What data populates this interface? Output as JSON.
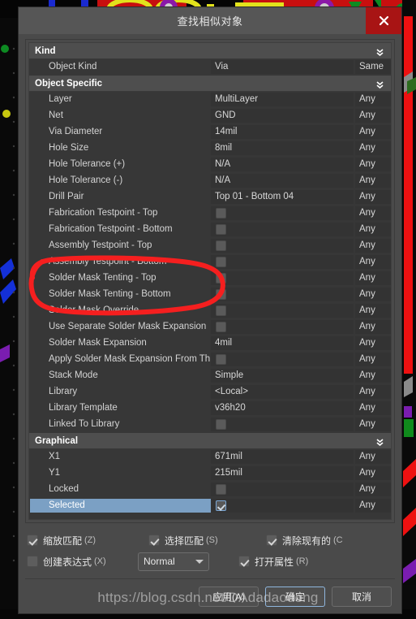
{
  "window": {
    "title": "查找相似对象",
    "close_label": "close-icon"
  },
  "grid": {
    "sections": [
      {
        "name": "Kind",
        "rows": [
          {
            "label": "Object Kind",
            "value": "Via",
            "type": "text",
            "mode": "Same"
          }
        ]
      },
      {
        "name": "Object Specific",
        "rows": [
          {
            "label": "Layer",
            "value": "MultiLayer",
            "type": "text",
            "mode": "Any"
          },
          {
            "label": "Net",
            "value": "GND",
            "type": "text",
            "mode": "Any"
          },
          {
            "label": "Via Diameter",
            "value": "14mil",
            "type": "text",
            "mode": "Any"
          },
          {
            "label": "Hole Size",
            "value": "8mil",
            "type": "text",
            "mode": "Any"
          },
          {
            "label": "Hole Tolerance (+)",
            "value": "N/A",
            "type": "text",
            "mode": "Any"
          },
          {
            "label": "Hole Tolerance (-)",
            "value": "N/A",
            "type": "text",
            "mode": "Any"
          },
          {
            "label": "Drill Pair",
            "value": "Top 01 - Bottom 04",
            "type": "text",
            "mode": "Any"
          },
          {
            "label": "Fabrication Testpoint - Top",
            "value": "",
            "type": "checkbox",
            "checked": false,
            "mode": "Any"
          },
          {
            "label": "Fabrication Testpoint - Bottom",
            "value": "",
            "type": "checkbox",
            "checked": false,
            "mode": "Any"
          },
          {
            "label": "Assembly Testpoint - Top",
            "value": "",
            "type": "checkbox",
            "checked": false,
            "mode": "Any"
          },
          {
            "label": "Assembly Testpoint - Bottom",
            "value": "",
            "type": "checkbox",
            "checked": false,
            "mode": "Any"
          },
          {
            "label": "Solder Mask Tenting - Top",
            "value": "",
            "type": "checkbox",
            "checked": false,
            "mode": "Any"
          },
          {
            "label": "Solder Mask Tenting - Bottom",
            "value": "",
            "type": "checkbox",
            "checked": false,
            "mode": "Any"
          },
          {
            "label": "Solder Mask Override",
            "value": "",
            "type": "checkbox",
            "checked": false,
            "mode": "Any"
          },
          {
            "label": "Use Separate Solder Mask Expansion",
            "value": "",
            "type": "checkbox",
            "checked": false,
            "mode": "Any"
          },
          {
            "label": "Solder Mask Expansion",
            "value": "4mil",
            "type": "text",
            "mode": "Any"
          },
          {
            "label": "Apply Solder Mask Expansion From Th",
            "value": "",
            "type": "checkbox",
            "checked": false,
            "mode": "Any"
          },
          {
            "label": "Stack Mode",
            "value": "Simple",
            "type": "text",
            "mode": "Any"
          },
          {
            "label": "Library",
            "value": "<Local>",
            "type": "text",
            "mode": "Any"
          },
          {
            "label": "Library Template",
            "value": "v36h20",
            "type": "text",
            "mode": "Any"
          },
          {
            "label": "Linked To Library",
            "value": "",
            "type": "checkbox",
            "checked": false,
            "mode": "Any"
          }
        ]
      },
      {
        "name": "Graphical",
        "rows": [
          {
            "label": "X1",
            "value": "671mil",
            "type": "text",
            "mode": "Any"
          },
          {
            "label": "Y1",
            "value": "215mil",
            "type": "text",
            "mode": "Any"
          },
          {
            "label": "Locked",
            "value": "",
            "type": "checkbox",
            "checked": false,
            "mode": "Any"
          },
          {
            "label": "Selected",
            "value": "",
            "type": "checkbox",
            "checked": true,
            "mode": "Any",
            "selected": true
          }
        ]
      }
    ]
  },
  "options": {
    "zoom_match": {
      "label": "缩放匹配",
      "accel": "(Z)",
      "checked": true
    },
    "select_match": {
      "label": "选择匹配",
      "accel": "(S)",
      "checked": true
    },
    "clear_existing": {
      "label": "清除现有的",
      "accel": "(C",
      "checked": true
    },
    "create_expression": {
      "label": "创建表达式",
      "accel": "(X)",
      "checked": false
    },
    "mode_select": {
      "value": "Normal"
    },
    "open_properties": {
      "label": "打开属性",
      "accel": "(R)",
      "checked": true
    }
  },
  "footer": {
    "apply": "应用(A)",
    "ok": "确定",
    "cancel": "取消"
  },
  "watermark": {
    "text": "https://blog.csdn.net/DAdadaodong"
  },
  "colors": {
    "accent_selected": "#7ba0c4",
    "close_red": "#a81414",
    "annotation_red": "#f51f1f",
    "dialog_bg": "#4a4a4a",
    "grid_bg": "#373737"
  }
}
